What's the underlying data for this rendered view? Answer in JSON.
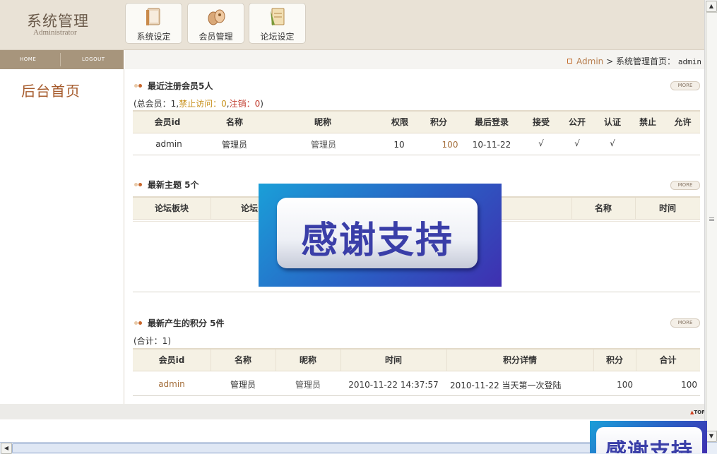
{
  "header": {
    "title": "系统管理",
    "subtitle": "Administrator",
    "nav": [
      {
        "label": "系统设定",
        "icon": "book-icon"
      },
      {
        "label": "会员管理",
        "icon": "members-icon"
      },
      {
        "label": "论坛设定",
        "icon": "forum-icon"
      }
    ]
  },
  "subnav": {
    "home": "HOME",
    "logout": "LOGOUT"
  },
  "breadcrumb": {
    "user": "Admin",
    "sep": ">",
    "page": "系统管理首页",
    "colon": "：",
    "login": "admin"
  },
  "sidebar": {
    "title": "后台首页"
  },
  "more_label": "MORE",
  "members": {
    "title": "最近注册会员5人",
    "summary": {
      "prefix": "(总会员：1,",
      "banned": "禁止访问：0",
      "comma": ",",
      "cancelled": "注销：0",
      "suffix": ")"
    },
    "columns": [
      "会员id",
      "名称",
      "昵称",
      "权限",
      "积分",
      "最后登录",
      "接受",
      "公开",
      "认证",
      "禁止",
      "允许"
    ],
    "rows": [
      {
        "id": "admin",
        "name": "管理员",
        "nick": "管理员",
        "perm": "10",
        "points": "100",
        "last": "10-11-22",
        "accept": "√",
        "public": "√",
        "verified": "√",
        "ban": "",
        "allow": ""
      }
    ]
  },
  "topics": {
    "title": "最新主题 5个",
    "columns": [
      "论坛板块",
      "论坛",
      "名称",
      "时间"
    ]
  },
  "points": {
    "title": "最新产生的积分 5件",
    "summary": "(合计：1)",
    "columns": [
      "会员id",
      "名称",
      "昵称",
      "时间",
      "积分详情",
      "积分",
      "合计"
    ],
    "rows": [
      {
        "id": "admin",
        "name": "管理员",
        "nick": "管理员",
        "time": "2010-11-22 14:37:57",
        "detail": "2010-11-22 当天第一次登陆",
        "points": "100",
        "total": "100"
      }
    ]
  },
  "footer": {
    "top": "TOP"
  },
  "overlay": {
    "text": "感谢支持"
  },
  "colors": {
    "accent": "#a65b2c",
    "header_bg": "#e9e2d6",
    "subbar": "#a7957c",
    "table_head": "#f5f1e4"
  }
}
